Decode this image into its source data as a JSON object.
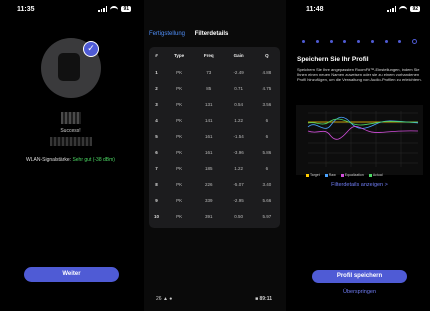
{
  "screens": {
    "s1": {
      "time": "11:35",
      "battery": "91",
      "success_label": "Success!",
      "wlan_label": "WLAN-Signalstärke:",
      "wlan_value": "Sehr gut (-38 dBm)",
      "button": "Weiter"
    },
    "s2": {
      "tab_preset": "Fertigstellung",
      "tab_details": "Filterdetails",
      "columns": [
        "#",
        "Type",
        "Freq",
        "Gain",
        "Q"
      ],
      "rows": [
        [
          "1",
          "PK",
          "73",
          "-2.49",
          "4.88"
        ],
        [
          "2",
          "PK",
          "85",
          "0.71",
          "4.75"
        ],
        [
          "3",
          "PK",
          "131",
          "0.54",
          "3.56"
        ],
        [
          "4",
          "PK",
          "141",
          "1.22",
          "6"
        ],
        [
          "5",
          "PK",
          "161",
          "-1.54",
          "6"
        ],
        [
          "6",
          "PK",
          "161",
          "-3.96",
          "5.86"
        ],
        [
          "7",
          "PK",
          "185",
          "1.22",
          "6"
        ],
        [
          "8",
          "PK",
          "226",
          "-5.07",
          "3.40"
        ],
        [
          "9",
          "PK",
          "339",
          "-2.95",
          "5.66"
        ],
        [
          "10",
          "PK",
          "391",
          "0.50",
          "5.97"
        ]
      ],
      "bottom_left": "26 ▲ ●",
      "bottom_right": "■ 89:11"
    },
    "s3": {
      "time": "11:48",
      "battery": "92",
      "title": "Speichern Sie Ihr Profil",
      "body": "Speichern Sie Ihre angepassten RoomFit™-Einstellungen, indem Sie Ihnen einen neuen Namen zuweisen oder sie zu einem vorhandenen Profil hinzufügen, um die Verwaltung von Audio-Profilen zu erleichtern.",
      "legend": [
        "Target",
        "Raw",
        "Equalization",
        "Actual"
      ],
      "legend_colors": [
        "#ffcc00",
        "#4aa3ff",
        "#d24ddb",
        "#4cd964"
      ],
      "filter_link": "Filterdetails anzeigen >",
      "save_button": "Profil speichern",
      "skip_link": "Überspringen"
    }
  }
}
